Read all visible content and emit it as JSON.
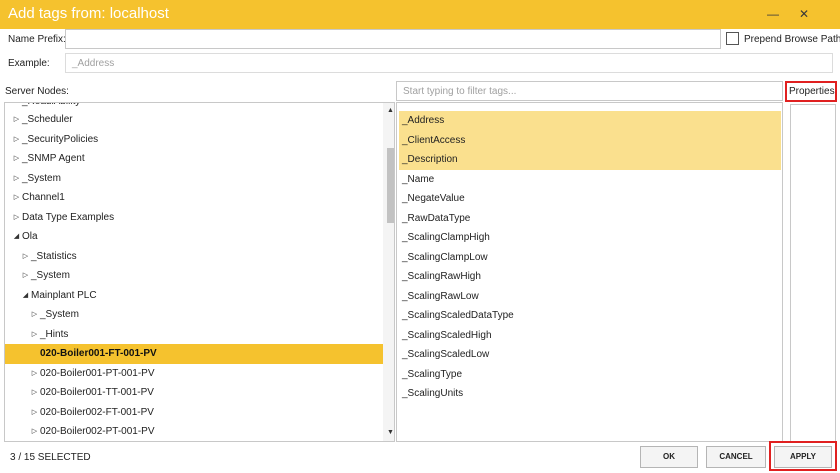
{
  "window": {
    "title": "Add tags from: localhost",
    "minimize_icon": "minimize-icon",
    "close_icon": "close-icon"
  },
  "name_prefix": {
    "label": "Name Prefix:",
    "value": ""
  },
  "prepend": {
    "label": "Prepend Browse Path",
    "checked": false
  },
  "example": {
    "label": "Example:",
    "value": "_Address"
  },
  "server_nodes": {
    "label": "Server Nodes:",
    "clipped_top": "_ReadiAbility",
    "items": [
      {
        "label": "_Scheduler",
        "state": "collapsed"
      },
      {
        "label": "_SecurityPolicies",
        "state": "collapsed"
      },
      {
        "label": "_SNMP Agent",
        "state": "collapsed"
      },
      {
        "label": "_System",
        "state": "collapsed"
      },
      {
        "label": "Channel1",
        "state": "collapsed"
      },
      {
        "label": "Data Type Examples",
        "state": "collapsed"
      },
      {
        "label": "Ola",
        "state": "expanded"
      },
      {
        "label": "_Statistics",
        "state": "collapsed"
      },
      {
        "label": "_System",
        "state": "collapsed"
      },
      {
        "label": "Mainplant PLC",
        "state": "expanded"
      },
      {
        "label": "_System",
        "state": "collapsed"
      },
      {
        "label": "_Hints",
        "state": "collapsed"
      },
      {
        "label": "020-Boiler001-FT-001-PV",
        "state": "leaf",
        "selected": true
      },
      {
        "label": "020-Boiler001-PT-001-PV",
        "state": "collapsed"
      },
      {
        "label": "020-Boiler001-TT-001-PV",
        "state": "collapsed"
      },
      {
        "label": "020-Boiler002-FT-001-PV",
        "state": "collapsed"
      },
      {
        "label": "020-Boiler002-PT-001-PV",
        "state": "collapsed"
      }
    ]
  },
  "filter": {
    "placeholder": "Start typing to filter tags..."
  },
  "tags": [
    {
      "label": "_Address",
      "selected": true
    },
    {
      "label": "_ClientAccess",
      "selected": true
    },
    {
      "label": "_Description",
      "selected": true
    },
    {
      "label": "_Name",
      "selected": false
    },
    {
      "label": "_NegateValue",
      "selected": false
    },
    {
      "label": "_RawDataType",
      "selected": false
    },
    {
      "label": "_ScalingClampHigh",
      "selected": false
    },
    {
      "label": "_ScalingClampLow",
      "selected": false
    },
    {
      "label": "_ScalingRawHigh",
      "selected": false
    },
    {
      "label": "_ScalingRawLow",
      "selected": false
    },
    {
      "label": "_ScalingScaledDataType",
      "selected": false
    },
    {
      "label": "_ScalingScaledHigh",
      "selected": false
    },
    {
      "label": "_ScalingScaledLow",
      "selected": false
    },
    {
      "label": "_ScalingType",
      "selected": false
    },
    {
      "label": "_ScalingUnits",
      "selected": false
    }
  ],
  "properties": {
    "label": "Properties:"
  },
  "footer": {
    "selected_count": 3,
    "total_count": 15,
    "status": "3 / 15 SELECTED",
    "ok": "OK",
    "cancel": "CANCEL",
    "apply": "APPLY"
  },
  "colors": {
    "accent": "#f5c22e",
    "tag_highlight": "#fae08e",
    "callout": "#e02020"
  }
}
